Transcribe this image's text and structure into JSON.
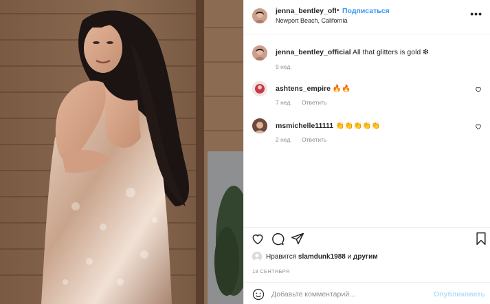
{
  "post": {
    "username": "jenna_bentley_offici",
    "dot": "•",
    "follow_label": "Подписаться",
    "location": "Newport Beach, California",
    "more_glyph": "•••"
  },
  "caption": {
    "username": "jenna_bentley_official",
    "text": "All that glitters is gold ❇",
    "time": "9 нед."
  },
  "comments": [
    {
      "username": "ashtens_empire",
      "text": "🔥🔥",
      "time": "7 нед.",
      "reply_label": "Ответить"
    },
    {
      "username": "msmichelle11111",
      "text": "👏👏👏👏👏",
      "time": "2 нед.",
      "reply_label": "Ответить"
    }
  ],
  "likes": {
    "prefix": "Нравится",
    "user": "slamdunk1988",
    "suffix": "и",
    "others": "другим"
  },
  "date": "18 СЕНТЯБРЯ",
  "add_comment": {
    "placeholder": "Добавьте комментарий...",
    "publish_label": "Опубликовать"
  },
  "colors": {
    "accent": "#3897f0",
    "publish_disabled": "#b2dffc",
    "secondary_text": "#8e8e8e"
  },
  "icons": [
    "heart-icon",
    "comment-icon",
    "share-icon",
    "bookmark-icon",
    "emoji-icon",
    "more-icon"
  ]
}
